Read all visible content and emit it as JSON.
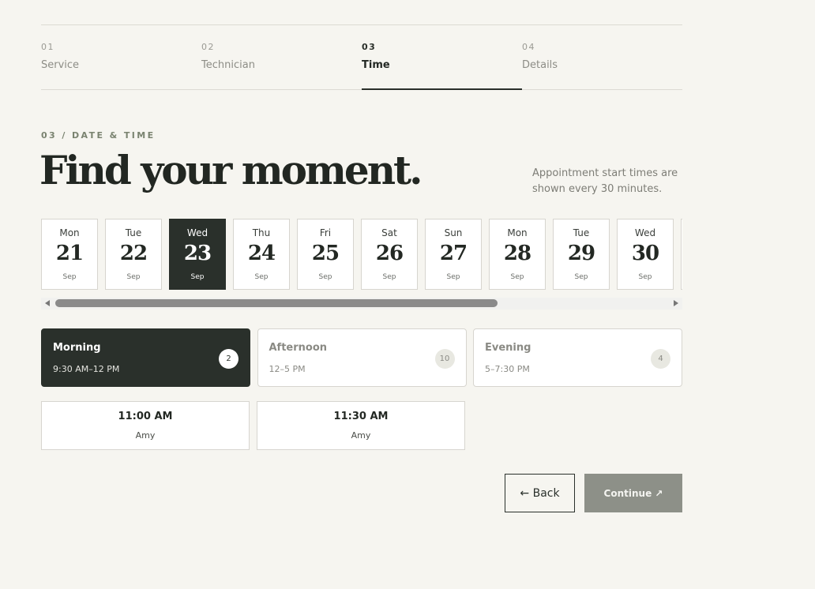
{
  "stepper": {
    "steps": [
      {
        "num": "01",
        "label": "Service"
      },
      {
        "num": "02",
        "label": "Technician"
      },
      {
        "num": "03",
        "label": "Time"
      },
      {
        "num": "04",
        "label": "Details"
      }
    ],
    "active_index": 2
  },
  "heading": {
    "eyebrow": "03 / DATE & TIME",
    "title": "Find your moment.",
    "note": "Appointment start times are shown every 30 minutes."
  },
  "dates": [
    {
      "dow": "Mon",
      "day": "21",
      "month": "Sep"
    },
    {
      "dow": "Tue",
      "day": "22",
      "month": "Sep"
    },
    {
      "dow": "Wed",
      "day": "23",
      "month": "Sep"
    },
    {
      "dow": "Thu",
      "day": "24",
      "month": "Sep"
    },
    {
      "dow": "Fri",
      "day": "25",
      "month": "Sep"
    },
    {
      "dow": "Sat",
      "day": "26",
      "month": "Sep"
    },
    {
      "dow": "Sun",
      "day": "27",
      "month": "Sep"
    },
    {
      "dow": "Mon",
      "day": "28",
      "month": "Sep"
    },
    {
      "dow": "Tue",
      "day": "29",
      "month": "Sep"
    },
    {
      "dow": "Wed",
      "day": "30",
      "month": "Sep"
    }
  ],
  "selected_date_index": 2,
  "periods": [
    {
      "name": "Morning",
      "range": "9:30 AM–12 PM",
      "count": "2"
    },
    {
      "name": "Afternoon",
      "range": "12–5 PM",
      "count": "10"
    },
    {
      "name": "Evening",
      "range": "5–7:30 PM",
      "count": "4"
    }
  ],
  "selected_period_index": 0,
  "slots": [
    {
      "time": "11:00 AM",
      "tech": "Amy"
    },
    {
      "time": "11:30 AM",
      "tech": "Amy"
    }
  ],
  "actions": {
    "back_label": "← Back",
    "continue_label": "Continue ↗"
  },
  "colors": {
    "background": "#f6f5f0",
    "selected": "#2a302b",
    "continue_disabled": "#8d9088"
  }
}
